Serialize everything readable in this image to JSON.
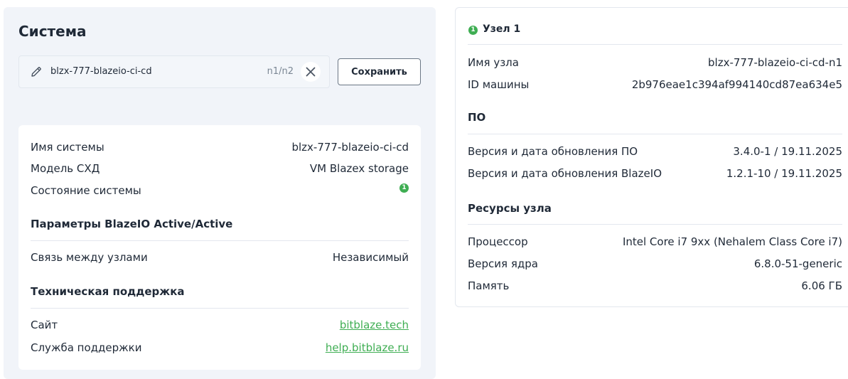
{
  "system": {
    "title": "Система",
    "name_input": {
      "value": "blzx-777-blazeio-ci-cd",
      "counter": "n1/n2"
    },
    "save_label": "Сохранить",
    "info": {
      "rows": [
        {
          "key": "Имя системы",
          "value": "blzx-777-blazeio-ci-cd"
        },
        {
          "key": "Модель СХД",
          "value": "VM Blazex storage"
        },
        {
          "key": "Состояние системы",
          "value": "1"
        }
      ],
      "active_section": {
        "title": "Параметры BlazeIO Active/Active",
        "rows": [
          {
            "key": "Связь между узлами",
            "value": "Независимый"
          }
        ]
      },
      "support_section": {
        "title": "Техническая поддержка",
        "rows": [
          {
            "key": "Сайт",
            "value": "bitblaze.tech"
          },
          {
            "key": "Служба поддержки",
            "value": "help.bitblaze.ru"
          }
        ]
      }
    }
  },
  "node": {
    "badge": "1",
    "title": "Узел 1",
    "rows": [
      {
        "key": "Имя узла",
        "value": "blzx-777-blazeio-ci-cd-n1"
      },
      {
        "key": "ID машины",
        "value": "2b976eae1c394af994140cd87ea634e5"
      }
    ],
    "software_section": {
      "title": "ПО",
      "rows": [
        {
          "key": "Версия и дата обновления ПО",
          "value": "3.4.0-1 / 19.11.2025"
        },
        {
          "key": "Версия и дата обновления BlazeIO",
          "value": "1.2.1-10 / 19.11.2025"
        }
      ]
    },
    "resources_section": {
      "title": "Ресурсы узла",
      "rows": [
        {
          "key": "Процессор",
          "value": "Intel Core i7 9xx (Nehalem Class Core i7)"
        },
        {
          "key": "Версия ядра",
          "value": "6.8.0-51-generic"
        },
        {
          "key": "Память",
          "value": "6.06 ГБ"
        }
      ]
    }
  },
  "colors": {
    "accent_green": "#3fae53",
    "panel_bg": "#f1f4f9",
    "text": "#1f2937",
    "muted": "#7b8794"
  },
  "icons": {
    "edit": "pencil-icon",
    "clear": "close-icon",
    "status": "status-ok-icon"
  }
}
